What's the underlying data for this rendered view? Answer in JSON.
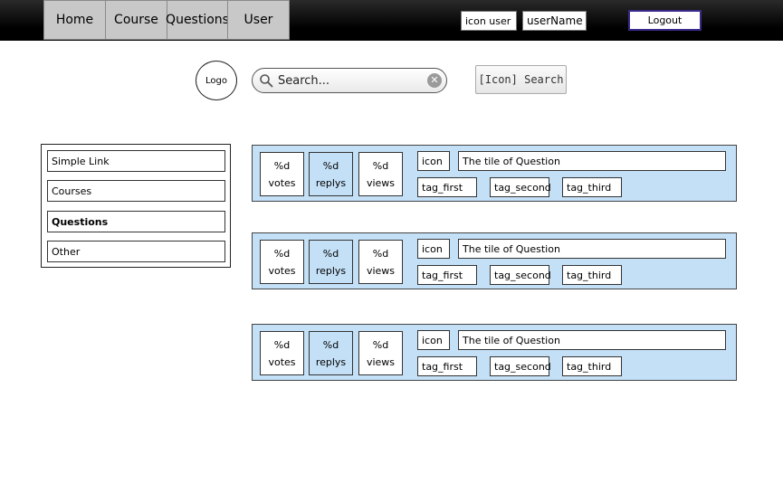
{
  "nav": {
    "tabs": [
      {
        "label": "Home"
      },
      {
        "label": "Course"
      },
      {
        "label": "Questions"
      },
      {
        "label": "User"
      }
    ],
    "icon_user": "icon user",
    "user_name": "userName",
    "logout_label": "Logout"
  },
  "header": {
    "logo_text": "Logo",
    "search_placeholder": "Search...",
    "search_button_label": "[Icon] Search"
  },
  "sidebar": {
    "items": [
      {
        "label": "Simple Link"
      },
      {
        "label": "Courses"
      },
      {
        "label": "Questions"
      },
      {
        "label": "Other"
      }
    ]
  },
  "questions": [
    {
      "votes_value": "%d",
      "votes_label": "votes",
      "replys_value": "%d",
      "replys_label": "replys",
      "views_value": "%d",
      "views_label": "views",
      "icon": "icon",
      "title": "The tile of Question",
      "tags": [
        "tag_first",
        "tag_second",
        "tag_third"
      ]
    },
    {
      "votes_value": "%d",
      "votes_label": "votes",
      "replys_value": "%d",
      "replys_label": "replys",
      "views_value": "%d",
      "views_label": "views",
      "icon": "icon",
      "title": "The tile of Question",
      "tags": [
        "tag_first",
        "tag_second",
        "tag_third"
      ]
    },
    {
      "votes_value": "%d",
      "votes_label": "votes",
      "replys_value": "%d",
      "replys_label": "replys",
      "views_value": "%d",
      "views_label": "views",
      "icon": "icon",
      "title": "The tile of Question",
      "tags": [
        "tag_first",
        "tag_second",
        "tag_third"
      ]
    }
  ],
  "colors": {
    "card_background": "#c4e0f7",
    "topbar": "#000000",
    "nav_tab": "#c8c8c8"
  }
}
